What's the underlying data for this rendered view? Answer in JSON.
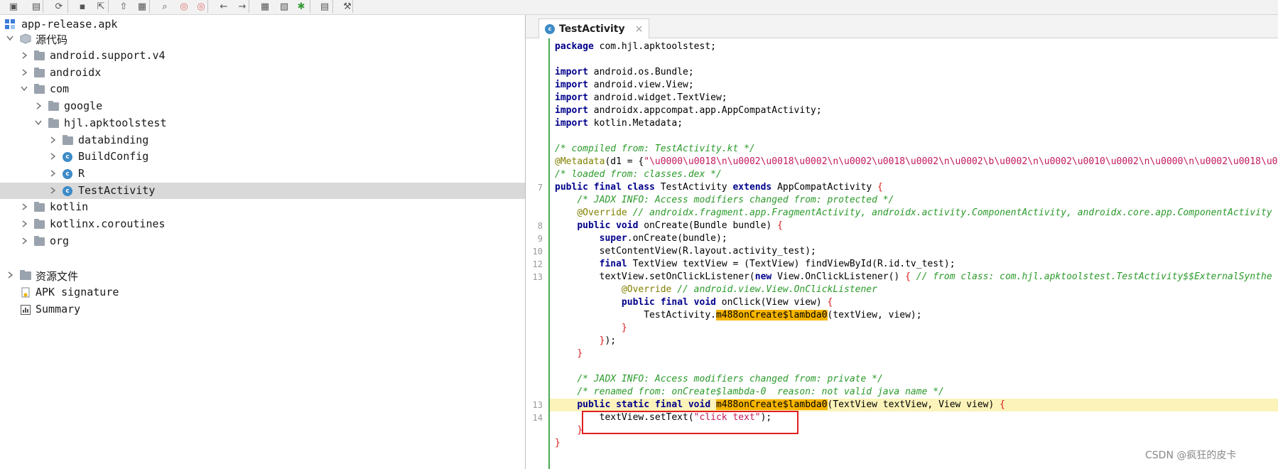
{
  "toolbar": {
    "icons": [
      "open-file-icon",
      "add-file-icon",
      "sync-icon",
      "save-icon",
      "export-icon",
      "flatten-icon",
      "package-icon",
      "search-icon",
      "find-class-icon",
      "find-usage-icon",
      "back-icon",
      "forward-icon",
      "decompile-icon",
      "code-view-icon",
      "debug-bug-icon",
      "log-icon",
      "settings-wrench-icon"
    ]
  },
  "tree": {
    "root": "app-release.apk",
    "source_node": "源代码",
    "items": [
      {
        "label": "android.support.v4"
      },
      {
        "label": "androidx"
      },
      {
        "label": "com"
      },
      {
        "label": "google"
      },
      {
        "label": "hjl.apktoolstest"
      },
      {
        "label": "databinding"
      },
      {
        "label": "BuildConfig"
      },
      {
        "label": "R"
      },
      {
        "label": "TestActivity"
      },
      {
        "label": "kotlin"
      },
      {
        "label": "kotlinx.coroutines"
      },
      {
        "label": "org"
      }
    ],
    "resources": "资源文件",
    "apk_signature": "APK signature",
    "summary": "Summary",
    "class_badge": "c"
  },
  "editor": {
    "tab_label": "TestActivity",
    "tab_close": "×",
    "line_numbers": [
      "7",
      "8",
      "9",
      "10",
      "12",
      "13",
      "13",
      "14"
    ],
    "lines": [
      {
        "parts": [
          {
            "t": "package",
            "c": "kw"
          },
          {
            "t": " com.hjl.apktoolstest;"
          }
        ]
      },
      {
        "parts": []
      },
      {
        "parts": [
          {
            "t": "import",
            "c": "kw"
          },
          {
            "t": " android.os.Bundle;"
          }
        ]
      },
      {
        "parts": [
          {
            "t": "import",
            "c": "kw"
          },
          {
            "t": " android.view.View;"
          }
        ]
      },
      {
        "parts": [
          {
            "t": "import",
            "c": "kw"
          },
          {
            "t": " android.widget.TextView;"
          }
        ]
      },
      {
        "parts": [
          {
            "t": "import",
            "c": "kw"
          },
          {
            "t": " androidx.appcompat.app.AppCompatActivity;"
          }
        ]
      },
      {
        "parts": [
          {
            "t": "import",
            "c": "kw"
          },
          {
            "t": " kotlin.Metadata;"
          }
        ]
      },
      {
        "parts": []
      },
      {
        "parts": [
          {
            "t": "/* compiled from: TestActivity.kt */",
            "c": "cm"
          }
        ]
      },
      {
        "parts": [
          {
            "t": "@Metadata",
            "c": "an"
          },
          {
            "t": "(d1 = {"
          },
          {
            "t": "\"\\u0000\\u0018\\n\\u0002\\u0018\\u0002\\n\\u0002\\u0018\\u0002\\n\\u0002\\b\\u0002\\n\\u0002\\u0010\\u0002\\n\\u0000\\n\\u0002\\u0018\\u0",
            "c": "st"
          }
        ]
      },
      {
        "parts": [
          {
            "t": "/* loaded from: classes.dex */",
            "c": "cm"
          }
        ]
      },
      {
        "parts": [
          {
            "t": "public final class",
            "c": "kw"
          },
          {
            "t": " TestActivity "
          },
          {
            "t": "extends",
            "c": "kw"
          },
          {
            "t": " AppCompatActivity "
          },
          {
            "t": "{",
            "c": "br"
          }
        ]
      },
      {
        "parts": [
          {
            "t": "    "
          },
          {
            "t": "/* JADX INFO: Access modifiers changed from: protected */",
            "c": "cm"
          }
        ]
      },
      {
        "parts": [
          {
            "t": "    "
          },
          {
            "t": "@Override",
            "c": "an"
          },
          {
            "t": " "
          },
          {
            "t": "// androidx.fragment.app.FragmentActivity, androidx.activity.ComponentActivity, androidx.core.app.ComponentActivity",
            "c": "cm"
          }
        ]
      },
      {
        "parts": [
          {
            "t": "    "
          },
          {
            "t": "public void",
            "c": "kw"
          },
          {
            "t": " onCreate(Bundle bundle) "
          },
          {
            "t": "{",
            "c": "br"
          }
        ]
      },
      {
        "parts": [
          {
            "t": "        "
          },
          {
            "t": "super",
            "c": "kw"
          },
          {
            "t": ".onCreate(bundle);"
          }
        ]
      },
      {
        "parts": [
          {
            "t": "        setContentView(R.layout.activity_test);"
          }
        ]
      },
      {
        "parts": [
          {
            "t": "        "
          },
          {
            "t": "final",
            "c": "kw"
          },
          {
            "t": " TextView textView = (TextView) findViewById(R.id.tv_test);"
          }
        ]
      },
      {
        "parts": [
          {
            "t": "        textView.setOnClickListener("
          },
          {
            "t": "new",
            "c": "kw"
          },
          {
            "t": " View.OnClickListener() "
          },
          {
            "t": "{",
            "c": "br"
          },
          {
            "t": " "
          },
          {
            "t": "// from class: com.hjl.apktoolstest.TestActivity$$ExternalSynthe",
            "c": "cm"
          }
        ]
      },
      {
        "parts": [
          {
            "t": "            "
          },
          {
            "t": "@Override",
            "c": "an"
          },
          {
            "t": " "
          },
          {
            "t": "// android.view.View.OnClickListener",
            "c": "cm"
          }
        ]
      },
      {
        "parts": [
          {
            "t": "            "
          },
          {
            "t": "public final void",
            "c": "kw"
          },
          {
            "t": " onClick(View view) "
          },
          {
            "t": "{",
            "c": "br"
          }
        ]
      },
      {
        "parts": [
          {
            "t": "                TestActivity."
          },
          {
            "t": "m488onCreate$lambda0",
            "c": "hlname"
          },
          {
            "t": "(textView, view);"
          }
        ]
      },
      {
        "parts": [
          {
            "t": "            "
          },
          {
            "t": "}",
            "c": "br"
          }
        ]
      },
      {
        "parts": [
          {
            "t": "        "
          },
          {
            "t": "}",
            "c": "br"
          },
          {
            "t": ");"
          }
        ]
      },
      {
        "parts": [
          {
            "t": "    "
          },
          {
            "t": "}",
            "c": "br"
          }
        ]
      },
      {
        "parts": []
      },
      {
        "parts": [
          {
            "t": "    "
          },
          {
            "t": "/* JADX INFO: Access modifiers changed from: private */",
            "c": "cm"
          }
        ]
      },
      {
        "parts": [
          {
            "t": "    "
          },
          {
            "t": "/* renamed from: onCreate$lambda-0  reason: not valid java name */",
            "c": "cm"
          }
        ]
      },
      {
        "parts": [
          {
            "t": "    "
          },
          {
            "t": "public static final void",
            "c": "kw"
          },
          {
            "t": " "
          },
          {
            "t": "m488onCreate$lambda0",
            "c": "hlname"
          },
          {
            "t": "(TextView textView, View view) "
          },
          {
            "t": "{",
            "c": "br"
          }
        ]
      },
      {
        "parts": [
          {
            "t": "        textView.setText("
          },
          {
            "t": "\"click text\"",
            "c": "st"
          },
          {
            "t": ");"
          }
        ]
      },
      {
        "parts": [
          {
            "t": "    "
          },
          {
            "t": "}",
            "c": "br"
          }
        ]
      },
      {
        "parts": [
          {
            "t": "}",
            "c": "br"
          }
        ]
      }
    ]
  },
  "watermark": "CSDN @疯狂的皮卡"
}
